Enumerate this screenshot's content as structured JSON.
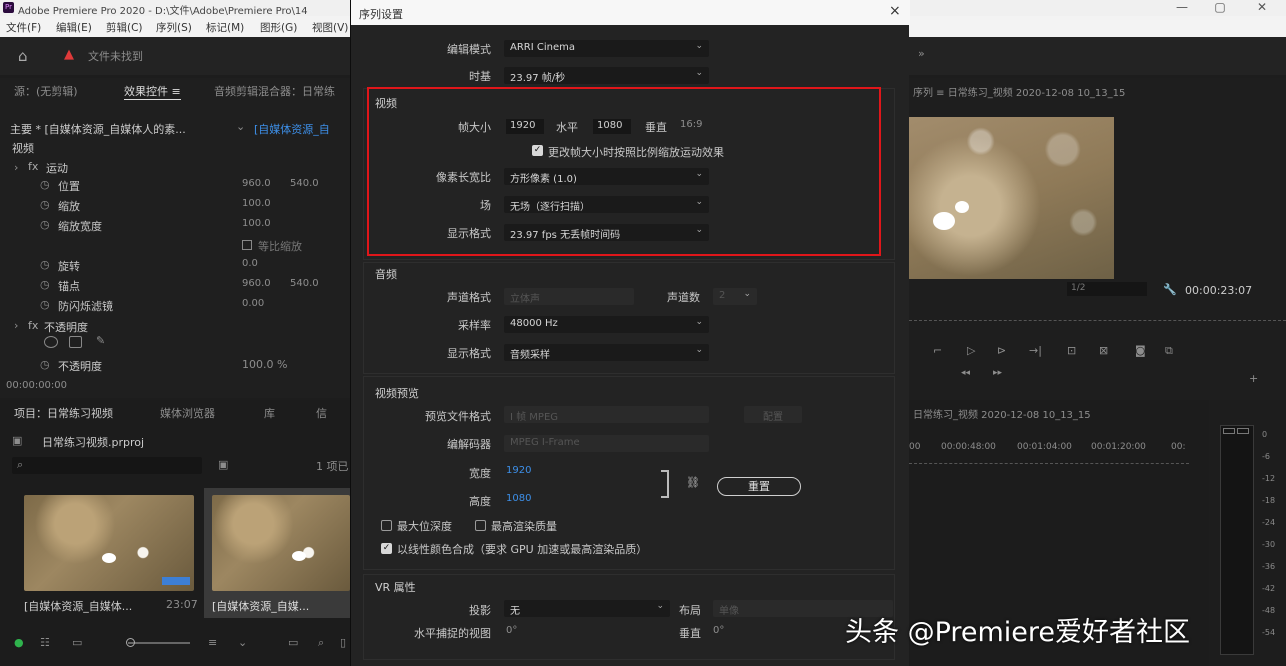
{
  "app": {
    "title": "Adobe Premiere Pro 2020 - D:\\文件\\Adobe\\Premiere Pro\\14",
    "menu": [
      "文件(F)",
      "编辑(E)",
      "剪辑(C)",
      "序列(S)",
      "标记(M)",
      "图形(G)",
      "视图(V)"
    ]
  },
  "left_panel": {
    "tabs": [
      "源：(无剪辑)",
      "效果控件 ≡",
      "音频剪辑混合器：日常练"
    ],
    "clip_selector": "主要 * [自媒体资源_自媒体人的素...",
    "clip_selector_right": "[自媒体资源_自",
    "section_video": "视频",
    "motion": "运动",
    "props": [
      {
        "name": "位置",
        "v1": "960.0",
        "v2": "540.0"
      },
      {
        "name": "缩放",
        "v1": "100.0",
        "v2": ""
      },
      {
        "name": "缩放宽度",
        "v1": "100.0",
        "v2": ""
      },
      {
        "name": "等比缩放",
        "v1": "",
        "v2": ""
      },
      {
        "name": "旋转",
        "v1": "0.0",
        "v2": ""
      },
      {
        "name": "锚点",
        "v1": "960.0",
        "v2": "540.0"
      },
      {
        "name": "防闪烁滤镜",
        "v1": "0.00",
        "v2": ""
      }
    ],
    "opacity_section": "不透明度",
    "opacity": "不透明度",
    "opacity_val": "100.0 %",
    "timecode": "00:00:00:00"
  },
  "project_panel": {
    "tabs": [
      "项目：日常练习视频",
      "媒体浏览器",
      "库",
      "信"
    ],
    "project_name": "日常练习视频.prproj",
    "search_placeholder": "",
    "count": "1 项已",
    "items": [
      {
        "label": "[自媒体资源_自媒体...",
        "duration": "23:07"
      },
      {
        "label": "[自媒体资源_自媒...",
        "duration": ""
      }
    ]
  },
  "monitor": {
    "title": "序列 ≡ 日常练习_视频 2020-12-08 10_13_15",
    "fit": "1/2",
    "timecode": "00:00:23:07"
  },
  "timeline": {
    "title": "日常练习_视频 2020-12-08 10_13_15",
    "ruler": [
      "00",
      "00:00:48:00",
      "00:01:04:00",
      "00:01:20:00",
      "00:"
    ],
    "meter_ticks": [
      "0",
      "-6",
      "-12",
      "-18",
      "-24",
      "-30",
      "-36",
      "-42",
      "-48",
      "-54"
    ]
  },
  "dialog": {
    "title": "序列设置",
    "close": "×",
    "editing_mode_label": "编辑模式",
    "editing_mode": "ARRI Cinema",
    "timebase_label": "时基",
    "timebase": "23.97 帧/秒",
    "video": {
      "heading": "视频",
      "frame_size_label": "帧大小",
      "frame_width": "1920",
      "horizontal_label": "水平",
      "frame_height": "1080",
      "vertical_label": "垂直",
      "aspect": "16:9",
      "scale_checkbox": "更改帧大小时按照比例缩放运动效果",
      "pixel_aspect_label": "像素长宽比",
      "pixel_aspect": "方形像素 (1.0)",
      "fields_label": "场",
      "fields": "无场（逐行扫描）",
      "display_format_label": "显示格式",
      "display_format": "23.97 fps 无丢帧时间码"
    },
    "audio": {
      "heading": "音频",
      "channel_format_label": "声道格式",
      "channel_format": "立体声",
      "channels_label": "声道数",
      "channels": "2",
      "sample_rate_label": "采样率",
      "sample_rate": "48000 Hz",
      "display_format_label": "显示格式",
      "display_format": "音频采样"
    },
    "preview": {
      "heading": "视频预览",
      "file_format_label": "预览文件格式",
      "file_format": "I 帧 MPEG",
      "config_button": "配置",
      "codec_label": "编解码器",
      "codec": "MPEG I-Frame",
      "width_label": "宽度",
      "width": "1920",
      "height_label": "高度",
      "height": "1080",
      "reset_button": "重置",
      "max_bit_depth": "最大位深度",
      "max_render_quality": "最高渲染质量",
      "linear_color": "以线性颜色合成（要求 GPU 加速或最高渲染品质）"
    },
    "vr": {
      "heading": "VR 属性",
      "projection_label": "投影",
      "projection": "无",
      "layout_label": "布局",
      "layout": "单像",
      "h_view_label": "水平捕捉的视图",
      "h_view": "0°",
      "v_label": "垂直",
      "v_view": "0°"
    }
  },
  "watermark": "头条 @Premiere爱好者社区"
}
